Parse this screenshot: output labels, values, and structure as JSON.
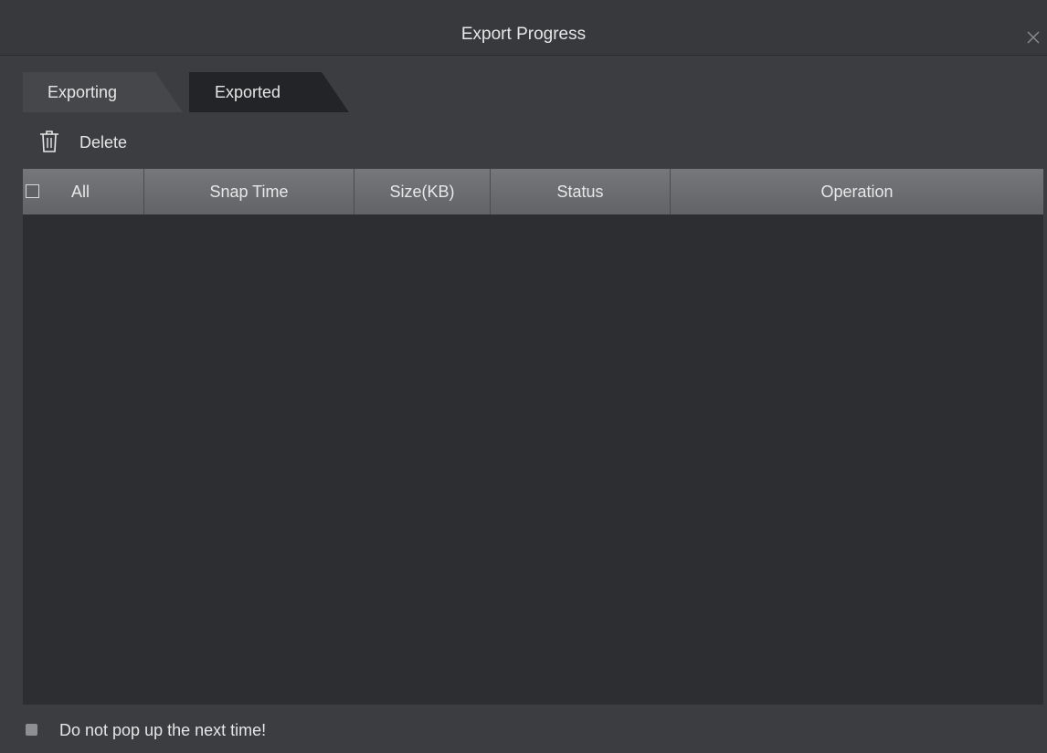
{
  "dialog": {
    "title": "Export Progress",
    "close_icon": "close-icon"
  },
  "tabs": [
    {
      "label": "Exporting",
      "active": false
    },
    {
      "label": "Exported",
      "active": true
    }
  ],
  "toolbar": {
    "delete_label": "Delete",
    "delete_icon": "trash-icon"
  },
  "table": {
    "select_all_label": "All",
    "columns": [
      "Snap Time",
      "Size(KB)",
      "Status",
      "Operation"
    ],
    "rows": []
  },
  "footer": {
    "dont_popup_label": "Do not pop up the next time!",
    "dont_popup_checked": false
  },
  "colors": {
    "window_bg": "#3b3d41",
    "table_bg": "#2c2e32",
    "header_bg": "#6b6d71",
    "active_tab_bg": "#232427",
    "text": "#e6e6e6"
  }
}
